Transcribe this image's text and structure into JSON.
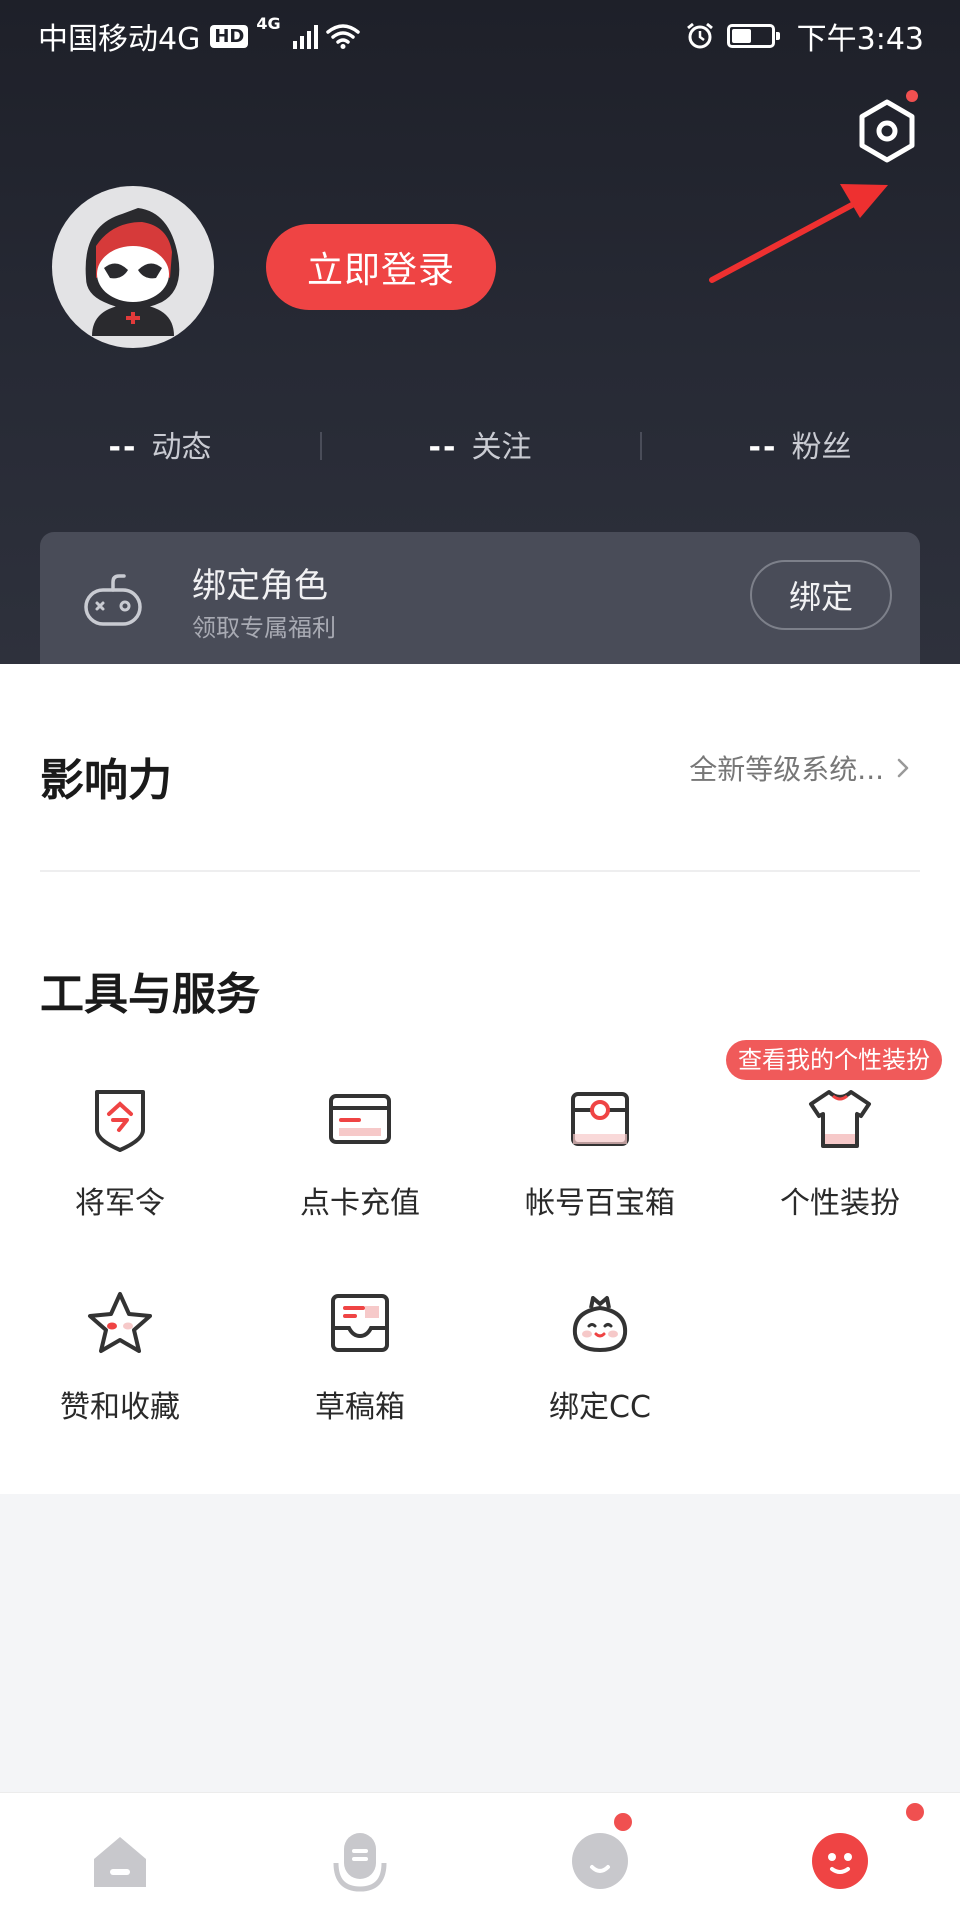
{
  "status_bar": {
    "carrier": "中国移动4G",
    "hd": "HD",
    "network": "4G",
    "time": "下午3:43",
    "battery_level": 0.5
  },
  "header": {
    "settings_icon": "settings-icon",
    "login_label": "立即登录",
    "stats": [
      {
        "value": "--",
        "label": "动态"
      },
      {
        "value": "--",
        "label": "关注"
      },
      {
        "value": "--",
        "label": "粉丝"
      }
    ],
    "bind_card": {
      "title": "绑定角色",
      "subtitle": "领取专属福利",
      "button_label": "绑定"
    }
  },
  "influence": {
    "title": "影响力",
    "link_text": "全新等级系统..."
  },
  "tools": {
    "title": "工具与服务",
    "tooltip": "查看我的个性装扮",
    "items": [
      {
        "label": "将军令",
        "icon": "shield-token-icon"
      },
      {
        "label": "点卡充值",
        "icon": "card-icon"
      },
      {
        "label": "帐号百宝箱",
        "icon": "treasure-box-icon"
      },
      {
        "label": "个性装扮",
        "icon": "tshirt-icon"
      },
      {
        "label": "赞和收藏",
        "icon": "star-icon"
      },
      {
        "label": "草稿箱",
        "icon": "drafts-icon"
      },
      {
        "label": "绑定CC",
        "icon": "cc-mascot-icon"
      }
    ]
  },
  "bottom_nav": {
    "items": [
      {
        "icon": "home-icon"
      },
      {
        "icon": "mic-icon"
      },
      {
        "icon": "chat-icon",
        "badge": true
      },
      {
        "icon": "profile-icon",
        "badge": true
      }
    ]
  },
  "colors": {
    "accent": "#ef4444",
    "header_bg": "#242732",
    "card_bg": "#494c58"
  }
}
